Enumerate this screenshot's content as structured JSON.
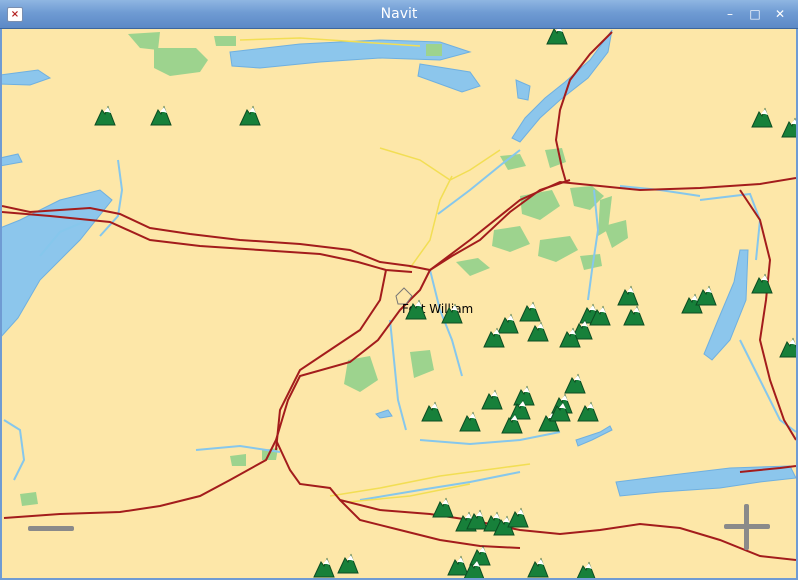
{
  "window": {
    "title": "Navit"
  },
  "titlebar_buttons": {
    "close": "×",
    "minimize": "–",
    "maximize": "□",
    "close_right": "✕"
  },
  "map": {
    "town_label": "Fort William",
    "icons": [
      "mountain-peak-icon"
    ],
    "colors": {
      "land": "#fde7a8",
      "water": "#8cc6ec",
      "forest": "#9dd38e",
      "road_main": "#a31c1c",
      "road_minor": "#f2de54",
      "river": "#86c7ec"
    }
  },
  "controls": {
    "zoom_out": "zoom-out-minus",
    "zoom_in": "zoom-in-plus"
  }
}
